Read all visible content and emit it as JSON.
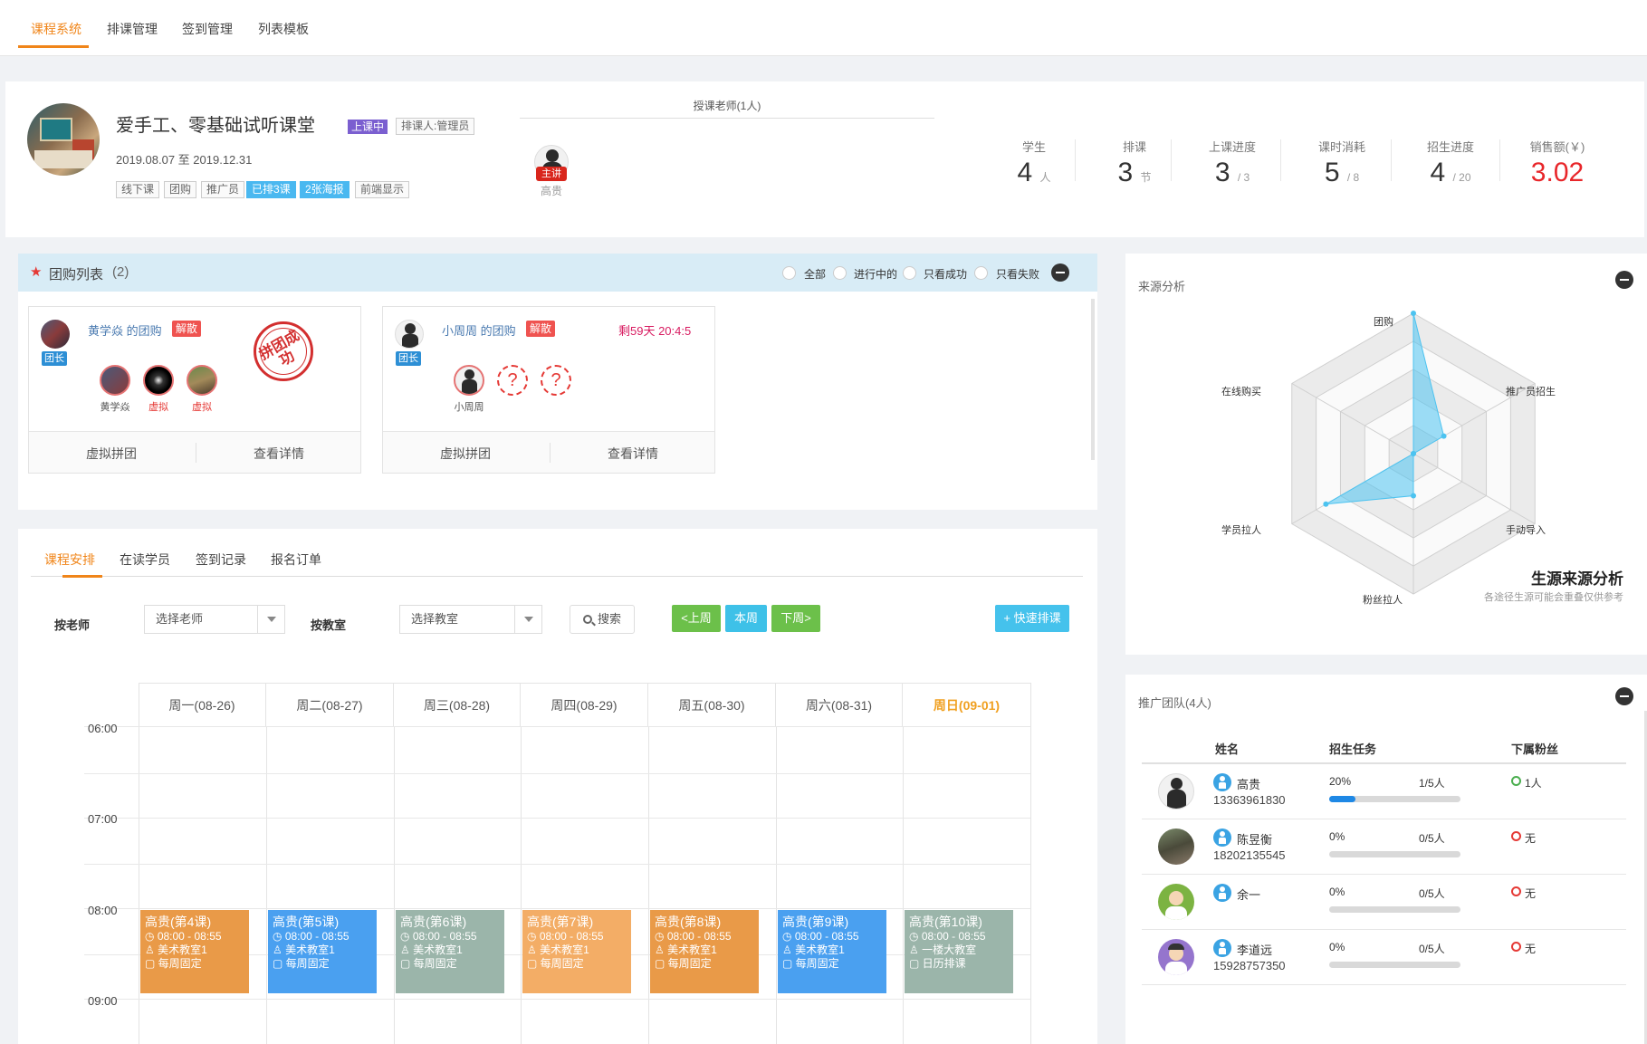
{
  "nav": {
    "tabs": [
      "课程系统",
      "排课管理",
      "签到管理",
      "列表模板"
    ],
    "active": 0
  },
  "course": {
    "title": "爱手工、零基础试听课堂",
    "status_badge": "上课中",
    "scheduler": "排课人:管理员",
    "dates": "2019.08.07 至 2019.12.31",
    "tags": [
      "线下课",
      "团购",
      "推广员",
      "已排3课",
      "2张海报",
      "前端显示"
    ],
    "teacher_header": "授课老师(1人)",
    "teacher_role": "主讲",
    "teacher_name": "高贵",
    "stats": [
      {
        "label": "学生",
        "value": "4",
        "unit": "人"
      },
      {
        "label": "排课",
        "value": "3",
        "unit": "节"
      },
      {
        "label": "上课进度",
        "value": "3",
        "unit": "/ 3"
      },
      {
        "label": "课时消耗",
        "value": "5",
        "unit": "/ 8"
      },
      {
        "label": "招生进度",
        "value": "4",
        "unit": "/ 20"
      },
      {
        "label": "销售额(￥)",
        "value": "3.02",
        "unit": ""
      }
    ]
  },
  "group": {
    "title": "团购列表",
    "count": "(2)",
    "filters": [
      "全部",
      "进行中的",
      "只看成功",
      "只看失败"
    ],
    "cards": [
      {
        "owner": "黄学焱 的团购",
        "badge": "解散",
        "leader": "团长",
        "members": [
          "黄学焱",
          "虚拟",
          "虚拟"
        ],
        "stamp": "拼团成功",
        "actions": [
          "虚拟拼团",
          "查看详情"
        ]
      },
      {
        "owner": "小周周 的团购",
        "badge": "解散",
        "leader": "团长",
        "countdown": "剩59天 20:4:5",
        "members": [
          "小周周",
          "?",
          "?"
        ],
        "actions": [
          "虚拟拼团",
          "查看详情"
        ]
      }
    ]
  },
  "schedule": {
    "tabs": [
      "课程安排",
      "在读学员",
      "签到记录",
      "报名订单"
    ],
    "teacher_label": "按老师",
    "teacher_placeholder": "选择老师",
    "room_label": "按教室",
    "room_placeholder": "选择教室",
    "search": "搜索",
    "prev": "<上周",
    "this_week": "本周",
    "next": "下周>",
    "quick": "+ 快速排课",
    "days": [
      "周一(08-26)",
      "周二(08-27)",
      "周三(08-28)",
      "周四(08-29)",
      "周五(08-30)",
      "周六(08-31)",
      "周日(09-01)"
    ],
    "times": [
      "06:00",
      "07:00",
      "08:00",
      "09:00"
    ],
    "events": [
      {
        "title": "高贵(第4课)",
        "time": "08:00 - 08:55",
        "room": "美术教室1",
        "mode": "每周固定",
        "color": "#e99a48"
      },
      {
        "title": "高贵(第5课)",
        "time": "08:00 - 08:55",
        "room": "美术教室1",
        "mode": "每周固定",
        "color": "#4aa0f0"
      },
      {
        "title": "高贵(第6课)",
        "time": "08:00 - 08:55",
        "room": "美术教室1",
        "mode": "每周固定",
        "color": "#9bb5aa"
      },
      {
        "title": "高贵(第7课)",
        "time": "08:00 - 08:55",
        "room": "美术教室1",
        "mode": "每周固定",
        "color": "#f3ad66"
      },
      {
        "title": "高贵(第8课)",
        "time": "08:00 - 08:55",
        "room": "美术教室1",
        "mode": "每周固定",
        "color": "#e99a48"
      },
      {
        "title": "高贵(第9课)",
        "time": "08:00 - 08:55",
        "room": "美术教室1",
        "mode": "每周固定",
        "color": "#4aa0f0"
      },
      {
        "title": "高贵(第10课)",
        "time": "08:00 - 08:55",
        "room": "一楼大教室",
        "mode": "日历排课",
        "color": "#9bb5aa"
      }
    ]
  },
  "source": {
    "title": "来源分析",
    "axes": [
      "团购",
      "推广员招生",
      "手动导入",
      "粉丝拉人",
      "学员拉人",
      "在线购买"
    ],
    "values": [
      1.0,
      0.25,
      0.0,
      0.3,
      0.72,
      0.0
    ],
    "heading": "生源来源分析",
    "subtitle": "各途径生源可能会重叠仅供参考"
  },
  "team": {
    "title": "推广团队(4人)",
    "columns": [
      "姓名",
      "招生任务",
      "下属粉丝"
    ],
    "members": [
      {
        "name": "高贵",
        "phone": "13363961830",
        "pct": "20%",
        "progress": 0.2,
        "quota": "1/5人",
        "fans": "1人",
        "fans_color": "#4caf50"
      },
      {
        "name": "陈昱衡",
        "phone": "18202135545",
        "pct": "0%",
        "progress": 0,
        "quota": "0/5人",
        "fans": "无",
        "fans_color": "#e53935"
      },
      {
        "name": "余一",
        "phone": "",
        "pct": "0%",
        "progress": 0,
        "quota": "0/5人",
        "fans": "无",
        "fans_color": "#e53935"
      },
      {
        "name": "李道远",
        "phone": "15928757350",
        "pct": "0%",
        "progress": 0,
        "quota": "0/5人",
        "fans": "无",
        "fans_color": "#e53935"
      }
    ]
  }
}
